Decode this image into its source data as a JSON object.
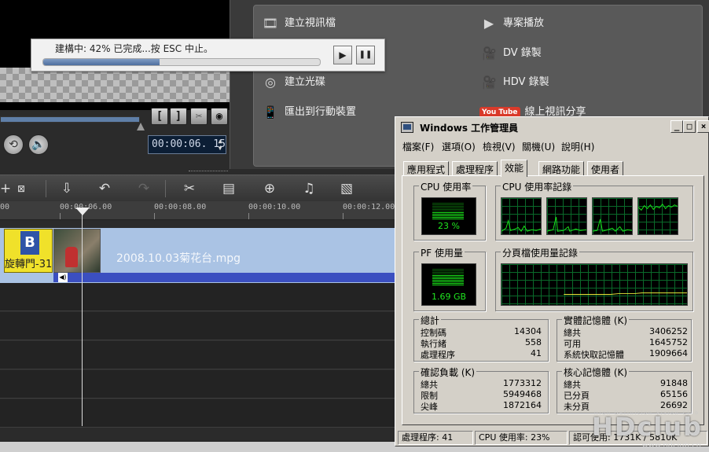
{
  "progress_dialog": {
    "text": "建構中: 42% 已完成...按 ESC 中止。",
    "progress": 0.42,
    "play_icon": "▶",
    "pause_icon": "❚❚"
  },
  "player": {
    "timecode": "00:00:06. 15",
    "mark_in": "[",
    "mark_out": "]"
  },
  "output_panel": {
    "items": [
      {
        "label": "建立視訊檔",
        "icon": "film-reel-icon"
      },
      {
        "label": "專案播放",
        "icon": "project-play-icon"
      },
      {
        "label": "DV 錄製",
        "icon": "dv-camera-icon"
      },
      {
        "label": "建立光碟",
        "icon": "disc-icon"
      },
      {
        "label": "HDV 錄製",
        "icon": "hdv-camera-icon"
      },
      {
        "label": "匯出到行動裝置",
        "icon": "mobile-device-icon"
      },
      {
        "label": "線上視訊分享",
        "icon": "youtube-icon",
        "badge": "You Tube"
      }
    ]
  },
  "timeline": {
    "ruler_labels": [
      "00",
      "00:00:06.00",
      "00:00:08.00",
      "00:00:10.00",
      "00:00:12.00"
    ],
    "clip_title_label": "旋轉門-31",
    "clip_name": "2008.10.03菊花台.mpg"
  },
  "taskmgr": {
    "title": "Windows 工作管理員",
    "window_buttons": {
      "minimize": "_",
      "maximize": "□",
      "close": "×"
    },
    "menus": [
      "檔案(F)",
      "選項(O)",
      "檢視(V)",
      "關機(U)",
      "說明(H)"
    ],
    "tabs": [
      "應用程式",
      "處理程序",
      "效能",
      "網路功能",
      "使用者"
    ],
    "active_tab": "效能",
    "cpu_usage": {
      "title": "CPU 使用率",
      "value": "23 %",
      "percent": 23
    },
    "cpu_history": {
      "title": "CPU 使用率記錄"
    },
    "pf_usage": {
      "title": "PF 使用量",
      "value": "1.69 GB"
    },
    "pf_history": {
      "title": "分頁檔使用量記錄"
    },
    "totals": {
      "title": "總計",
      "rows": [
        {
          "label": "控制碼",
          "value": "14304"
        },
        {
          "label": "執行緒",
          "value": "558"
        },
        {
          "label": "處理程序",
          "value": "41"
        }
      ]
    },
    "physical_memory": {
      "title": "實體記憶體 (K)",
      "rows": [
        {
          "label": "總共",
          "value": "3406252"
        },
        {
          "label": "可用",
          "value": "1645752"
        },
        {
          "label": "系統快取記憶體",
          "value": "1909664"
        }
      ]
    },
    "commit_charge": {
      "title": "確認負載 (K)",
      "rows": [
        {
          "label": "總共",
          "value": "1773312"
        },
        {
          "label": "限制",
          "value": "5949468"
        },
        {
          "label": "尖峰",
          "value": "1872164"
        }
      ]
    },
    "kernel_memory": {
      "title": "核心記憶體 (K)",
      "rows": [
        {
          "label": "總共",
          "value": "91848"
        },
        {
          "label": "已分頁",
          "value": "65156"
        },
        {
          "label": "未分頁",
          "value": "26692"
        }
      ]
    },
    "status": {
      "processes": "處理程序: 41",
      "cpu": "CPU 使用率: 23%",
      "commit": "認可使用: 1731K / 5810K"
    }
  },
  "watermark": {
    "logo": "HDclub",
    "tagline": "High Definition Vision Club",
    "url": "www.hdclub.cn"
  },
  "colors": {
    "accent_blue": "#4e6f9f",
    "meter_green": "#1fe61f",
    "clip_blue": "#aac3e4"
  }
}
